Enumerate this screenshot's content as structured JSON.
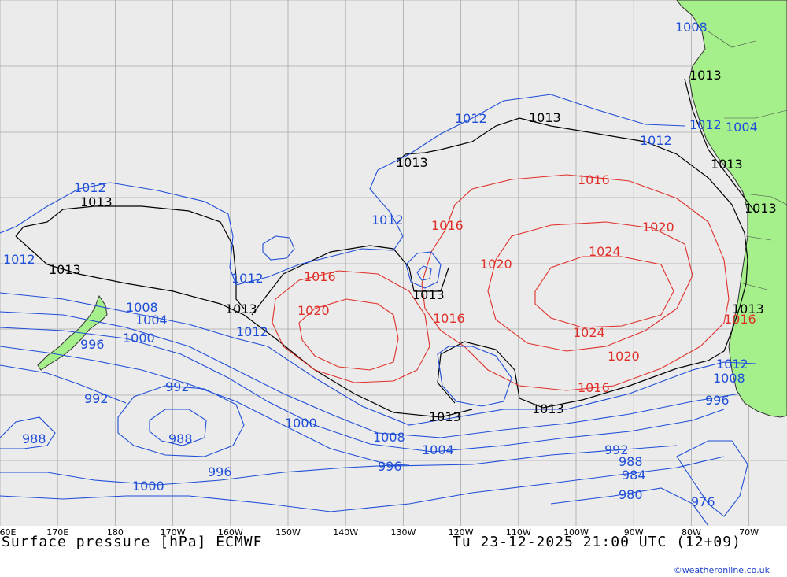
{
  "map": {
    "longitude_ticks": [
      {
        "label": "60E",
        "lon": 160
      },
      {
        "label": "170E",
        "lon": 170
      },
      {
        "label": "180",
        "lon": 180
      },
      {
        "label": "170W",
        "lon": 190
      },
      {
        "label": "160W",
        "lon": 200
      },
      {
        "label": "150W",
        "lon": 210
      },
      {
        "label": "140W",
        "lon": 220
      },
      {
        "label": "130W",
        "lon": 230
      },
      {
        "label": "120W",
        "lon": 240
      },
      {
        "label": "110W",
        "lon": 250
      },
      {
        "label": "100W",
        "lon": 260
      },
      {
        "label": "90W",
        "lon": 270
      },
      {
        "label": "80W",
        "lon": 280
      },
      {
        "label": "70W",
        "lon": 290
      }
    ],
    "isobar_labels": [
      {
        "text": "1013",
        "kind": "ref"
      },
      {
        "text": "1012",
        "kind": "low"
      },
      {
        "text": "1008",
        "kind": "low"
      },
      {
        "text": "1004",
        "kind": "low"
      },
      {
        "text": "1000",
        "kind": "low"
      },
      {
        "text": "996",
        "kind": "low"
      },
      {
        "text": "992",
        "kind": "low"
      },
      {
        "text": "988",
        "kind": "low"
      },
      {
        "text": "984",
        "kind": "low"
      },
      {
        "text": "980",
        "kind": "low"
      },
      {
        "text": "976",
        "kind": "low"
      },
      {
        "text": "1016",
        "kind": "high"
      },
      {
        "text": "1020",
        "kind": "high"
      },
      {
        "text": "1024",
        "kind": "high"
      }
    ],
    "colors": {
      "ocean": "#ebebeb",
      "land": "#a6f08c",
      "grid": "#aaaaaa",
      "low_isobar": "#1f4ed8",
      "high_isobar": "#e0302a",
      "ref_isobar": "#000000"
    }
  },
  "caption": {
    "left": "Surface pressure [hPa] ECMWF",
    "right": "Tu 23-12-2025 21:00 UTC (12+09)"
  },
  "credit": "©weatheronline.co.uk"
}
